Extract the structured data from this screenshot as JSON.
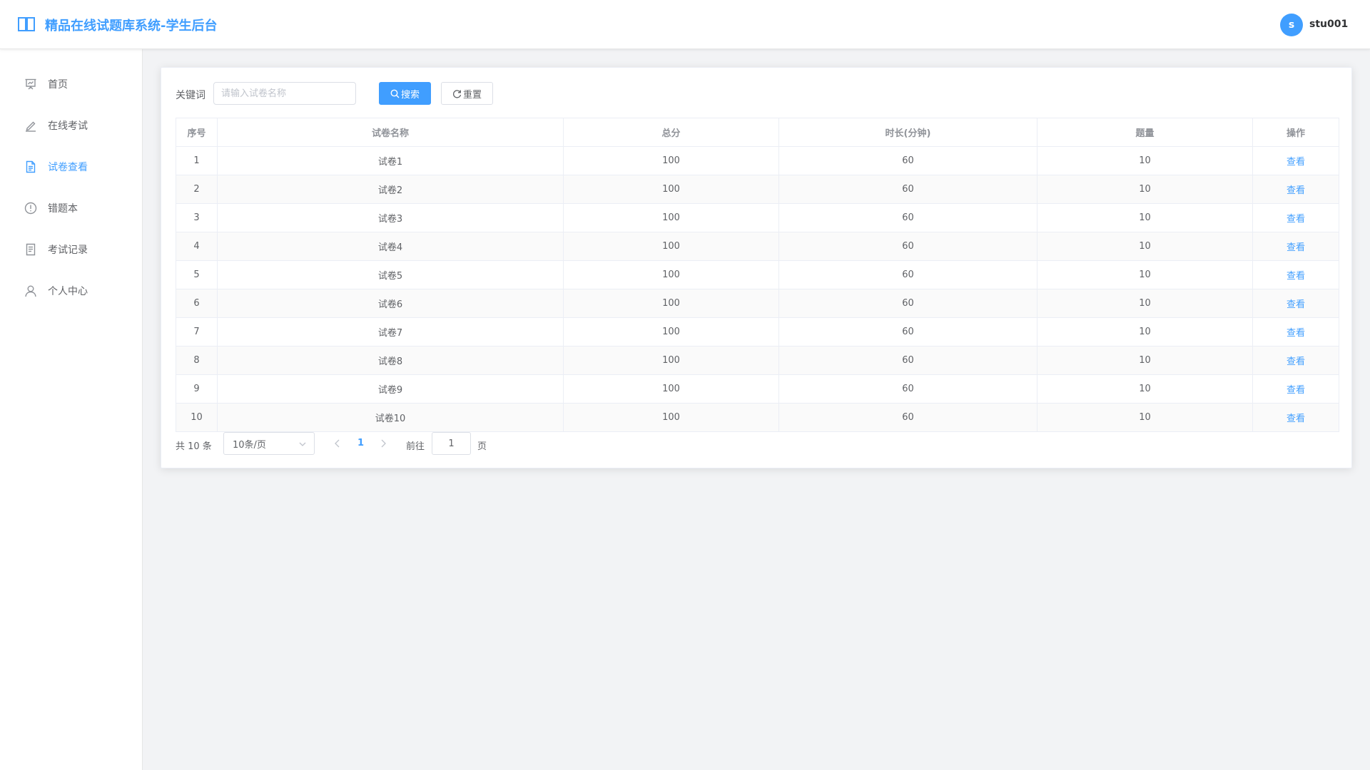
{
  "header": {
    "title": "精品在线试题库系统-学生后台",
    "avatar_letter": "s",
    "username": "stu001",
    "logo_icon": "book-open-icon"
  },
  "colors": {
    "accent": "#409eff",
    "sidebar_bg": "#ffffff",
    "page_bg": "#f2f3f5"
  },
  "sidebar": {
    "items": [
      {
        "label": "首页",
        "icon": "presentation-icon",
        "active": false
      },
      {
        "label": "在线考试",
        "icon": "edit-pen-icon",
        "active": false
      },
      {
        "label": "试卷查看",
        "icon": "document-icon",
        "active": true
      },
      {
        "label": "错题本",
        "icon": "warning-circle-icon",
        "active": false
      },
      {
        "label": "考试记录",
        "icon": "notebook-icon",
        "active": false
      },
      {
        "label": "个人中心",
        "icon": "user-icon",
        "active": false
      }
    ]
  },
  "search": {
    "label": "关键词",
    "placeholder": "请输入试卷名称",
    "value": "",
    "search_button": "搜索",
    "reset_button": "重置"
  },
  "table": {
    "columns": [
      "序号",
      "试卷名称",
      "总分",
      "时长(分钟)",
      "题量",
      "操作"
    ],
    "rows": [
      {
        "index": "1",
        "name": "试卷1",
        "score": "100",
        "duration": "60",
        "count": "10",
        "action": "查看"
      },
      {
        "index": "2",
        "name": "试卷2",
        "score": "100",
        "duration": "60",
        "count": "10",
        "action": "查看"
      },
      {
        "index": "3",
        "name": "试卷3",
        "score": "100",
        "duration": "60",
        "count": "10",
        "action": "查看"
      },
      {
        "index": "4",
        "name": "试卷4",
        "score": "100",
        "duration": "60",
        "count": "10",
        "action": "查看"
      },
      {
        "index": "5",
        "name": "试卷5",
        "score": "100",
        "duration": "60",
        "count": "10",
        "action": "查看"
      },
      {
        "index": "6",
        "name": "试卷6",
        "score": "100",
        "duration": "60",
        "count": "10",
        "action": "查看"
      },
      {
        "index": "7",
        "name": "试卷7",
        "score": "100",
        "duration": "60",
        "count": "10",
        "action": "查看"
      },
      {
        "index": "8",
        "name": "试卷8",
        "score": "100",
        "duration": "60",
        "count": "10",
        "action": "查看"
      },
      {
        "index": "9",
        "name": "试卷9",
        "score": "100",
        "duration": "60",
        "count": "10",
        "action": "查看"
      },
      {
        "index": "10",
        "name": "试卷10",
        "score": "100",
        "duration": "60",
        "count": "10",
        "action": "查看"
      }
    ]
  },
  "pagination": {
    "total_text": "共 10 条",
    "page_size": "10条/页",
    "current_page": "1",
    "goto_label": "前往",
    "goto_value": "1",
    "page_suffix": "页"
  }
}
